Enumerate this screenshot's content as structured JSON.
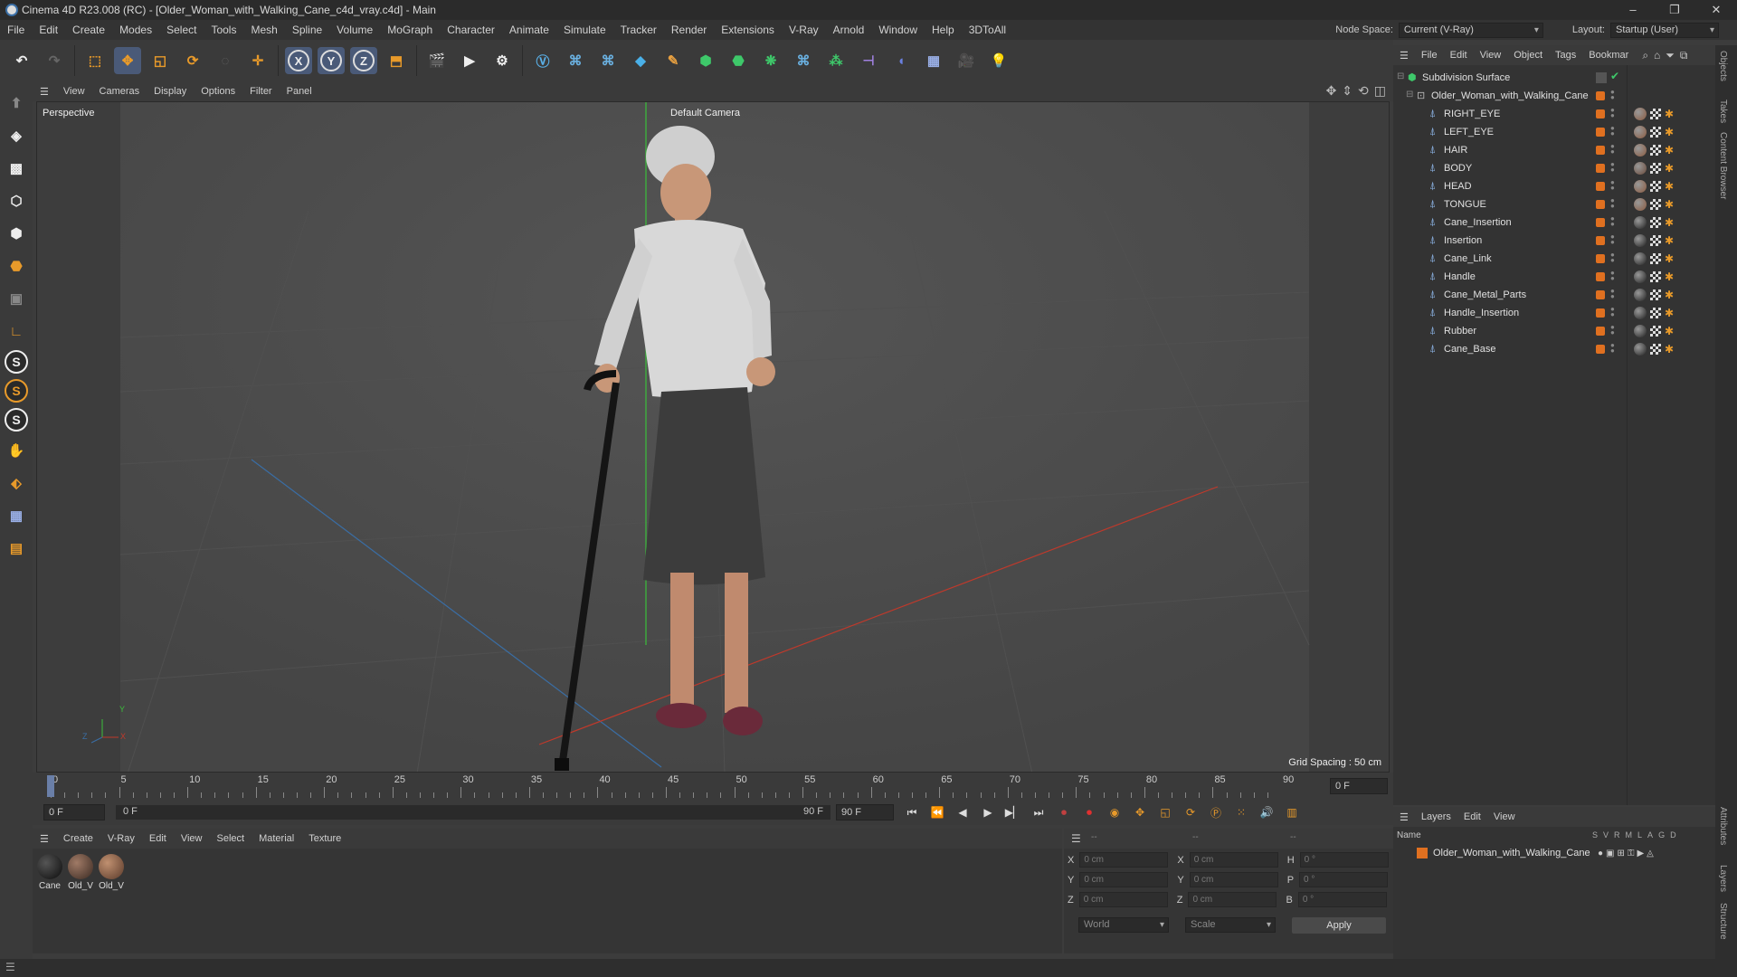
{
  "window": {
    "title": "Cinema 4D R23.008 (RC) - [Older_Woman_with_Walking_Cane_c4d_vray.c4d] - Main",
    "controls": [
      "–",
      "❐",
      "✕"
    ]
  },
  "menu": [
    "File",
    "Edit",
    "Create",
    "Modes",
    "Select",
    "Tools",
    "Mesh",
    "Spline",
    "Volume",
    "MoGraph",
    "Character",
    "Animate",
    "Simulate",
    "Tracker",
    "Render",
    "Extensions",
    "V-Ray",
    "Arnold",
    "Window",
    "Help",
    "3DToAll"
  ],
  "node_space": {
    "label": "Node Space:",
    "value": "Current (V-Ray)"
  },
  "layout": {
    "label": "Layout:",
    "value": "Startup (User)"
  },
  "toolbar": {
    "axis_x": "X",
    "axis_y": "Y",
    "axis_z": "Z"
  },
  "viewport": {
    "menu": [
      "View",
      "Cameras",
      "Display",
      "Options",
      "Filter",
      "Panel"
    ],
    "name": "Perspective",
    "camera": "Default Camera",
    "grid_spacing": "Grid Spacing : 50 cm",
    "axis_x": "X",
    "axis_y": "Y",
    "axis_z": "Z"
  },
  "timeline": {
    "ticks": [
      "0",
      "5",
      "10",
      "15",
      "20",
      "25",
      "30",
      "35",
      "40",
      "45",
      "50",
      "55",
      "60",
      "65",
      "70",
      "75",
      "80",
      "85",
      "90"
    ],
    "current_frame": "0 F"
  },
  "transport": {
    "start": "0 F",
    "range_start": "0 F",
    "range_end": "90 F",
    "end": "90 F"
  },
  "material_manager": {
    "menu": [
      "Create",
      "V-Ray",
      "Edit",
      "View",
      "Select",
      "Material",
      "Texture"
    ],
    "materials": [
      {
        "label": "Cane",
        "color": "#1e1e1e"
      },
      {
        "label": "Old_V",
        "color": "#6a4a3a"
      },
      {
        "label": "Old_V",
        "color": "#8a5a40"
      }
    ]
  },
  "coordinates": {
    "header_left": "--",
    "header_mid": "--",
    "header_right": "--",
    "rows": [
      {
        "pos_label": "X",
        "pos": "0 cm",
        "size_label": "X",
        "size": "0 cm",
        "rot_label": "H",
        "rot": "0 °"
      },
      {
        "pos_label": "Y",
        "pos": "0 cm",
        "size_label": "Y",
        "size": "0 cm",
        "rot_label": "P",
        "rot": "0 °"
      },
      {
        "pos_label": "Z",
        "pos": "0 cm",
        "size_label": "Z",
        "size": "0 cm",
        "rot_label": "B",
        "rot": "0 °"
      }
    ],
    "mode": "World",
    "scale": "Scale",
    "apply": "Apply"
  },
  "object_manager": {
    "menu": [
      "File",
      "Edit",
      "View",
      "Object",
      "Tags",
      "Bookmar"
    ],
    "root": "Subdivision Surface",
    "group": "Older_Woman_with_Walking_Cane",
    "objects": [
      {
        "name": "RIGHT_EYE",
        "mat": "#8a5a40"
      },
      {
        "name": "LEFT_EYE",
        "mat": "#8a5a40"
      },
      {
        "name": "HAIR",
        "mat": "#8a5a40"
      },
      {
        "name": "BODY",
        "mat": "#6a4a3a"
      },
      {
        "name": "HEAD",
        "mat": "#8a5a40"
      },
      {
        "name": "TONGUE",
        "mat": "#8a5a40"
      },
      {
        "name": "Cane_Insertion",
        "mat": "#1e1e1e"
      },
      {
        "name": "Insertion",
        "mat": "#1e1e1e"
      },
      {
        "name": "Cane_Link",
        "mat": "#1e1e1e"
      },
      {
        "name": "Handle",
        "mat": "#1e1e1e"
      },
      {
        "name": "Cane_Metal_Parts",
        "mat": "#1e1e1e"
      },
      {
        "name": "Handle_Insertion",
        "mat": "#1e1e1e"
      },
      {
        "name": "Rubber",
        "mat": "#1e1e1e"
      },
      {
        "name": "Cane_Base",
        "mat": "#1e1e1e"
      }
    ]
  },
  "layers": {
    "menu": [
      "Layers",
      "Edit",
      "View"
    ],
    "col_name": "Name",
    "cols": [
      "S",
      "V",
      "R",
      "M",
      "L",
      "A",
      "G",
      "D"
    ],
    "items": [
      "Older_Woman_with_Walking_Cane"
    ]
  },
  "side_tabs": [
    "Objects",
    "Takes",
    "Content Browser",
    "Attributes",
    "Layers",
    "Structure"
  ],
  "colors": {
    "accent_orange": "#e07020",
    "selection_blue": "#4a5a78",
    "x_axis": "#c0392b",
    "z_axis": "#3a6ea5",
    "y_axis": "#3bbf3b"
  }
}
